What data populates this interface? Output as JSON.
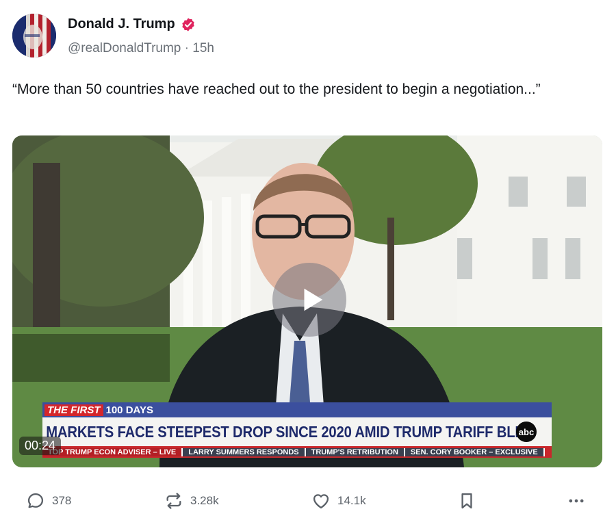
{
  "author": {
    "display_name": "Donald J. Trump",
    "handle": "@realDonaldTrump",
    "separator": "·",
    "time_ago": "15h",
    "verified_color": "#e0245e"
  },
  "post": {
    "text": "“More than 50 countries have reached out to the president to begin a negotiation...”"
  },
  "video": {
    "timestamp": "00:24",
    "chyron": {
      "brand_prefix": "THE FIRST",
      "brand_suffix": "100 DAYS",
      "headline": "MARKETS FACE STEEPEST DROP SINCE 2020 AMID TRUMP TARIFF BLITZ",
      "network": "abc",
      "ticker": [
        "TOP TRUMP ECON ADVISER – LIVE",
        "LARRY SUMMERS RESPONDS",
        "TRUMP'S RETRIBUTION",
        "SEN. CORY BOOKER – EXCLUSIVE"
      ]
    }
  },
  "actions": {
    "reply_count": "378",
    "repost_count": "3.28k",
    "like_count": "14.1k"
  }
}
